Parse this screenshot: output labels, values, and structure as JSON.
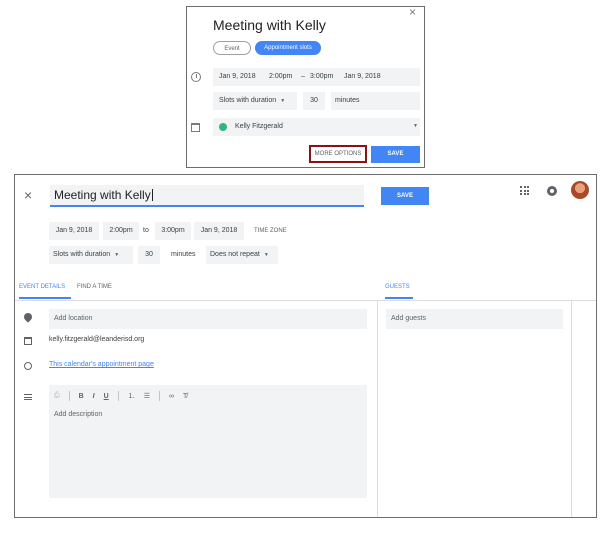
{
  "dialog": {
    "title": "Meeting with Kelly",
    "chip_event": "Event",
    "chip_slots": "Appointment slots",
    "start_date": "Jan 9, 2018",
    "start_time": "2:00pm",
    "dash": "–",
    "end_time": "3:00pm",
    "end_date": "Jan 9, 2018",
    "slots_label": "Slots with duration",
    "duration": "30",
    "minutes": "minutes",
    "calendar_name": "Kelly Fitzgerald",
    "more_options": "MORE OPTIONS",
    "save": "SAVE",
    "close": "×",
    "calendar_color": "#33b679"
  },
  "editor": {
    "close": "×",
    "title": "Meeting with Kelly",
    "save": "SAVE",
    "start_date": "Jan 9, 2018",
    "start_time": "2:00pm",
    "to": "to",
    "end_time": "3:00pm",
    "end_date": "Jan 9, 2018",
    "time_zone": "TIME ZONE",
    "slots_label": "Slots with duration",
    "duration": "30",
    "minutes": "minutes",
    "repeat": "Does not repeat",
    "tabs": {
      "event_details": "EVENT DETAILS",
      "find_a_time": "FIND A TIME",
      "guests": "GUESTS"
    },
    "location_placeholder": "Add location",
    "owner_email": "kelly.fitzgerald@leanderisd.org",
    "appointment_link": "This calendar's appointment page",
    "description_placeholder": "Add description",
    "guests_placeholder": "Add guests",
    "toolbar": {
      "attach": "⎙",
      "bold": "B",
      "italic": "I",
      "underline": "U",
      "numbered": "⒈",
      "bulleted": "☰",
      "link": "∞",
      "clear": "T̸"
    }
  },
  "colors": {
    "accent": "#4285f4",
    "highlight_border": "#8b1212"
  }
}
